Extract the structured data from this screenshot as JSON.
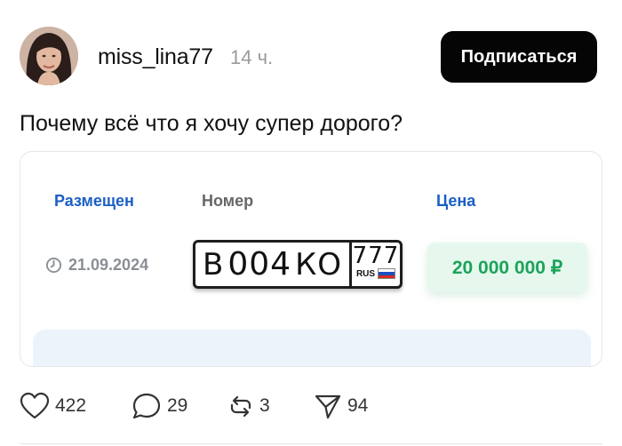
{
  "post": {
    "username": "miss_lina77",
    "time": "14 ч.",
    "subscribe_label": "Подписаться",
    "text": "Почему всё что я хочу супер дорого?"
  },
  "listing": {
    "headers": {
      "placed": "Размещен",
      "number": "Номер",
      "price": "Цена"
    },
    "date": "21.09.2024",
    "plate": {
      "letter1": "В",
      "digits": "004",
      "letters": "КО",
      "region": "777",
      "country": "RUS"
    },
    "price": "20 000 000 ₽",
    "price_color": "#1ca35a",
    "accent_color": "#1b5fc5"
  },
  "actions": {
    "likes": "422",
    "comments": "29",
    "reposts": "3",
    "shares": "94",
    "icons": [
      "heart-icon",
      "comment-icon",
      "repost-icon",
      "share-icon"
    ]
  }
}
